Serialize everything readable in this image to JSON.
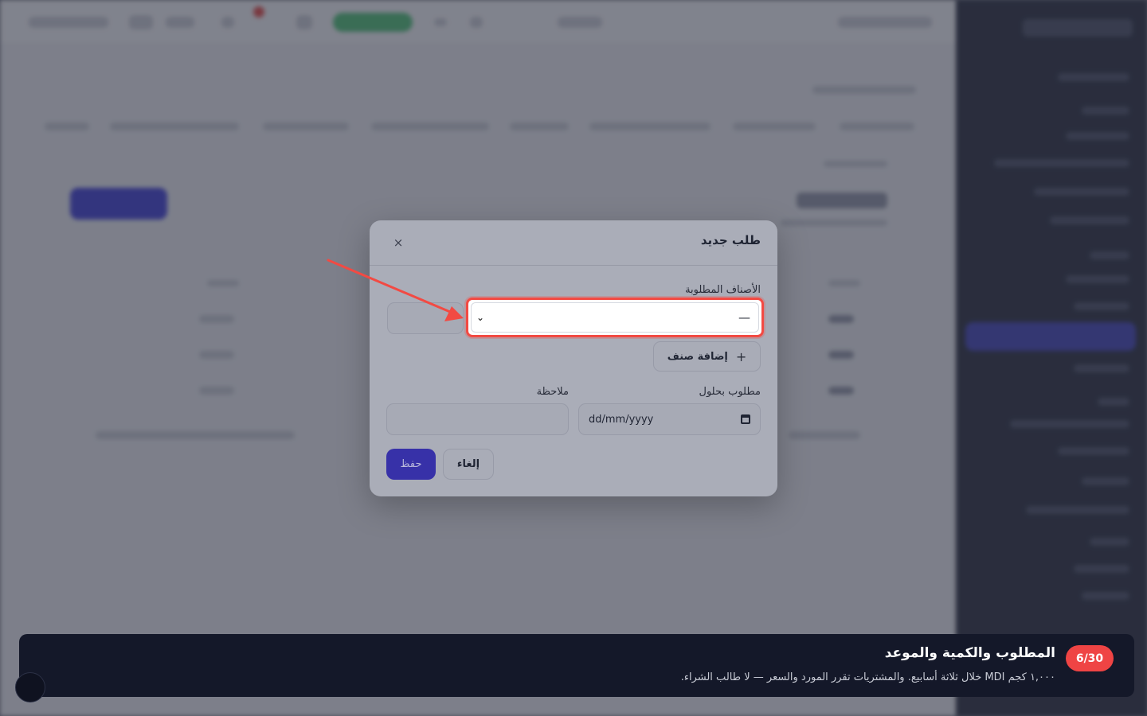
{
  "modal": {
    "title": "طلب جديد",
    "close_icon": "×",
    "items_label": "الأصناف المطلوبة",
    "item_select_value": "—",
    "chevron_icon": "⌄",
    "add_item_label": "إضافة صنف",
    "plus_icon": "+",
    "due_label": "مطلوب بحلول",
    "note_label": "ملاحظة",
    "date_placeholder": "dd/mm/yyyy",
    "cancel_label": "إلغاء",
    "save_label": "حفظ"
  },
  "tutorial": {
    "step": "6/30",
    "title": "المطلوب والكمية والموعد",
    "text": "١,٠٠٠ كجم MDI خلال ثلاثة أسابيع. والمشتريات تقرر المورد والسعر — لا طالب الشراء."
  },
  "colors": {
    "highlight": "#f24a43",
    "primary": "#3731a8",
    "badge": "#ef4444",
    "banner": "#141829"
  }
}
